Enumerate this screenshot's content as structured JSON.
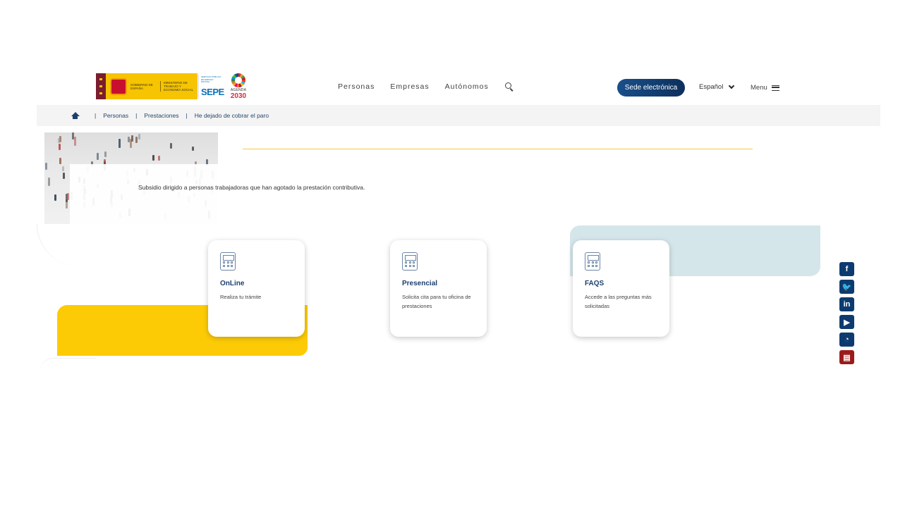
{
  "header": {
    "logo_gobierno": "Gobierno de España",
    "logo_ministerio": "Ministerio de Trabajo y Economía Social",
    "logo_sepe_small": "Servicio Público de Empleo Estatal",
    "logo_sepe": "SEPE",
    "logo_agenda_label": "AGENDA",
    "logo_agenda_year": "2030",
    "nav": [
      "Personas",
      "Empresas",
      "Autónomos"
    ],
    "search_icon": "search-icon",
    "sede_button": "Sede electrónica",
    "language": "Español",
    "menu_label": "Menu"
  },
  "breadcrumb": {
    "home_icon": "home-icon",
    "items": [
      "Personas",
      "Prestaciones",
      "He dejado de cobrar el paro"
    ]
  },
  "hero": {
    "description": "Subsidio dirigido a personas trabajadoras que han agotado la prestación contributiva."
  },
  "cards": [
    {
      "icon": "calculator-icon",
      "title": "OnLine",
      "text": "Realiza tu trámite"
    },
    {
      "icon": "calculator-icon",
      "title": "Presencial",
      "text": "Solicita cita para tu oficina de prestaciones"
    },
    {
      "icon": "calculator-icon",
      "title": "FAQS",
      "text": "Accede a las preguntas más solicitadas"
    }
  ],
  "social": [
    {
      "icon": "facebook-icon",
      "glyph": "f"
    },
    {
      "icon": "twitter-icon",
      "glyph": "🐦"
    },
    {
      "icon": "linkedin-icon",
      "glyph": "in"
    },
    {
      "icon": "youtube-icon",
      "glyph": "▶"
    },
    {
      "icon": "rss-icon",
      "glyph": "◔"
    },
    {
      "icon": "pdf-icon",
      "glyph": "▤"
    }
  ],
  "colors": {
    "brand_navy": "#1c3f6e",
    "accent_yellow": "#fdcb06",
    "accent_light_blue": "#d5e6ea",
    "pdf_red": "#9a1b1b"
  }
}
